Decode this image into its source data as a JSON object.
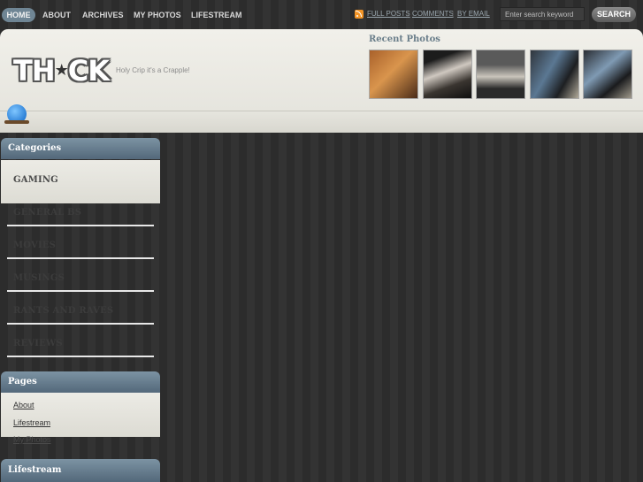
{
  "nav": {
    "items": [
      {
        "label": "HOME"
      },
      {
        "label": "ABOUT"
      },
      {
        "label": "ARCHIVES"
      },
      {
        "label": "MY PHOTOS"
      },
      {
        "label": "LIFESTREAM"
      }
    ]
  },
  "feeds": {
    "full_posts": "FULL POSTS",
    "comments": "COMMENTS",
    "by_email": "BY EMAIL",
    "separator": "|"
  },
  "search": {
    "placeholder": "Enter search keyword",
    "button": "SEARCH"
  },
  "header": {
    "logo_left": "TH",
    "logo_star": "★",
    "logo_right": "CK",
    "tagline": "Holy Crip it's a Crapple!",
    "recent_photos_title": "Recent Photos"
  },
  "categories": {
    "title": "Categories",
    "items": [
      {
        "label": "GAMING"
      },
      {
        "label": "GENERAL BS"
      },
      {
        "label": "MOVIES"
      },
      {
        "label": "MUSINGS"
      },
      {
        "label": "RANTS AND RAVES"
      },
      {
        "label": "REVIEWS"
      }
    ]
  },
  "pages": {
    "title": "Pages",
    "items": [
      {
        "label": "About"
      },
      {
        "label": "Lifestream"
      },
      {
        "label": "My Photos"
      }
    ]
  },
  "lifestream": {
    "title": "Lifestream"
  },
  "colors": {
    "accent": "#6f8594",
    "widget_header": "#53687a",
    "rss": "#f29426"
  }
}
